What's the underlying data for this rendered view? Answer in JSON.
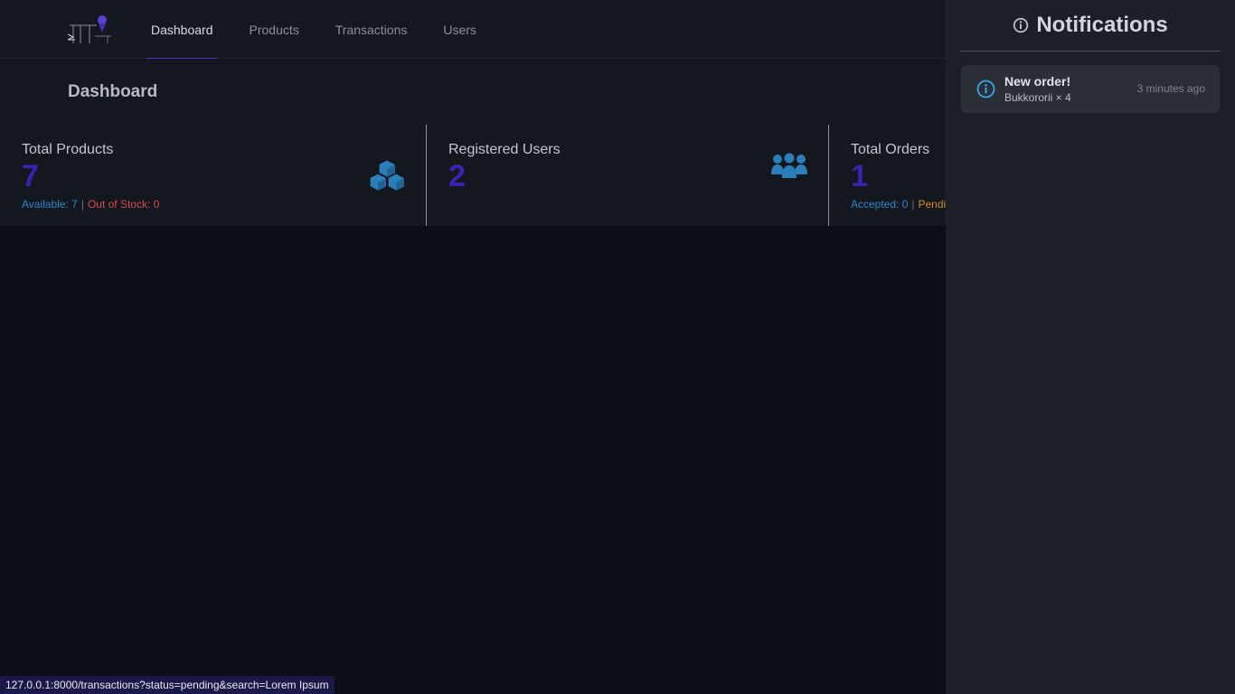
{
  "nav": {
    "links": [
      {
        "label": "Dashboard"
      },
      {
        "label": "Products"
      },
      {
        "label": "Transactions"
      },
      {
        "label": "Users"
      }
    ]
  },
  "page": {
    "title": "Dashboard"
  },
  "stats": [
    {
      "label": "Total Products",
      "value": "7",
      "sub": [
        {
          "text": "Available: 7",
          "color": "#2f86c9"
        },
        {
          "text": "Out of Stock: 0",
          "color": "#d64a4a"
        }
      ],
      "icon": "cubes-icon"
    },
    {
      "label": "Registered Users",
      "value": "2",
      "icon": "users-icon"
    },
    {
      "label": "Total Orders",
      "value": "1",
      "sub": [
        {
          "text": "Accepted: 0",
          "color": "#2f86c9"
        },
        {
          "text": "Pendi",
          "color": "#d68a1f"
        }
      ]
    }
  ],
  "notifications": {
    "title": "Notifications",
    "items": [
      {
        "title": "New order!",
        "body": "Bukkororii × 4",
        "time": "3 minutes ago"
      }
    ]
  },
  "statusbar": {
    "url": "127.0.0.1:8000/transactions?status=pending&search=Lorem Ipsum"
  },
  "colors": {
    "accent": "#3b22b5",
    "icon_blue": "#2a7fb8",
    "info": "#3aa8e8"
  }
}
